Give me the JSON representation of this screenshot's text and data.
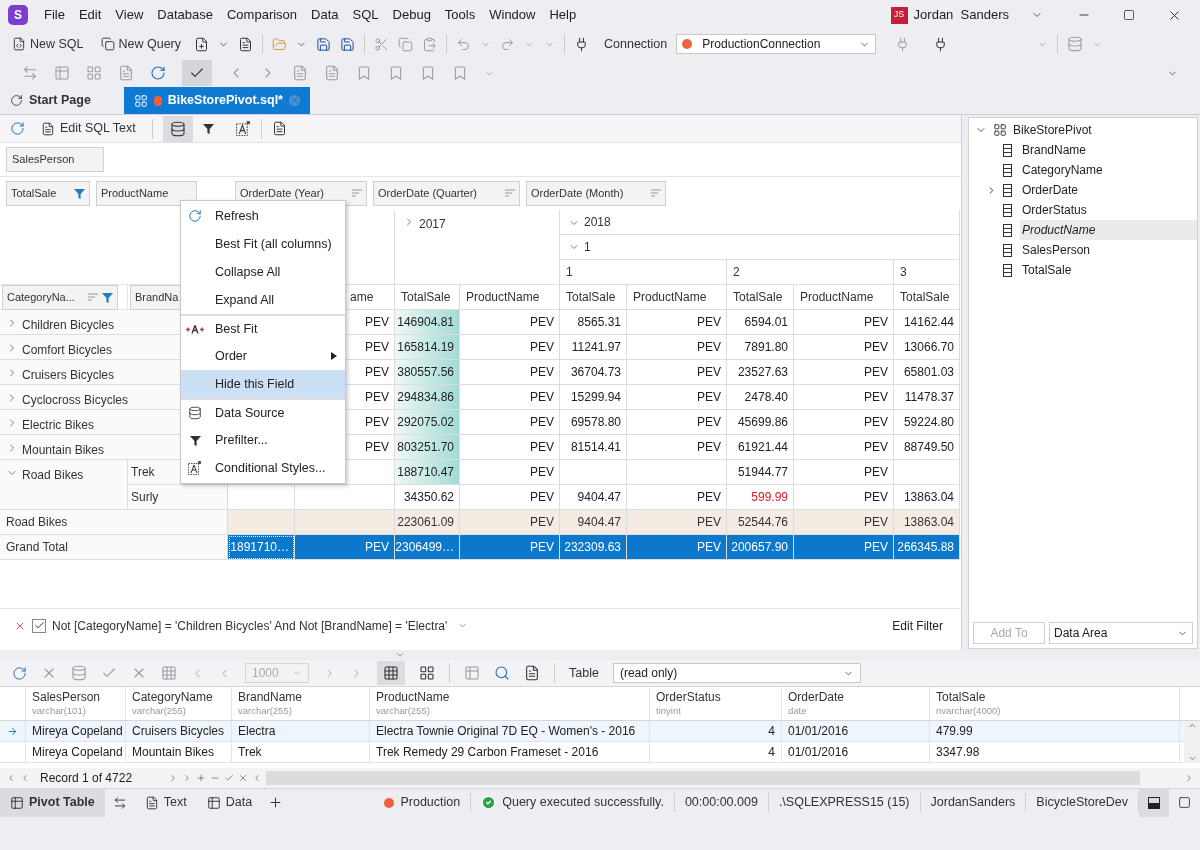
{
  "app": {
    "logo": "S",
    "menu": [
      "File",
      "Edit",
      "View",
      "Database",
      "Comparison",
      "Data",
      "SQL",
      "Debug",
      "Tools",
      "Window",
      "Help"
    ],
    "user": {
      "initials": "JS",
      "name": "Jordan  Sanders"
    }
  },
  "toolbar": {
    "buttons": [
      "New SQL",
      "New Query"
    ],
    "connection_label": "Connection",
    "connection": "ProductionConnection"
  },
  "doc_tabs": [
    {
      "label": "Start Page",
      "selected": false
    },
    {
      "label": "BikeStorePivot.sql*",
      "selected": true
    }
  ],
  "pivot_toolbar": {
    "edit_sql": "Edit SQL Text"
  },
  "pivot": {
    "filter_fields": [
      "SalesPerson"
    ],
    "data_fields": [
      {
        "label": "TotalSale",
        "filtered": true,
        "sorted": false
      },
      {
        "label": "ProductName",
        "filtered": false,
        "sorted": false
      }
    ],
    "column_fields": [
      {
        "label": "OrderDate (Year)",
        "filtered": false,
        "sorted": true
      },
      {
        "label": "OrderDate (Quarter)",
        "filtered": false,
        "sorted": true
      },
      {
        "label": "OrderDate (Month)",
        "filtered": false,
        "sorted": true
      }
    ],
    "row_fields": [
      {
        "label": "CategoryNa...",
        "filtered": true,
        "sorted": true
      },
      {
        "label": "BrandNa"
      }
    ],
    "years": [
      {
        "label": "2017",
        "expanded": false
      },
      {
        "label": "2018",
        "expanded": true
      }
    ],
    "quarters": [
      {
        "label": "1",
        "expanded": true
      }
    ],
    "months": [
      "1",
      "2",
      "3"
    ],
    "measure_headers": [
      "ame",
      "TotalSale",
      "ProductName",
      "TotalSale",
      "ProductName",
      "TotalSale",
      "ProductName",
      "TotalSale"
    ],
    "categories": [
      {
        "label": "Children Bicycles",
        "expanded": false,
        "cells": [
          null,
          "PEV",
          {
            "text": "146904.81",
            "kind": "databar"
          },
          "PEV",
          "8565.31",
          "PEV",
          "6594.01",
          "PEV",
          "14162.44"
        ]
      },
      {
        "label": "Comfort Bicycles",
        "expanded": false,
        "cells": [
          null,
          "PEV",
          {
            "text": "165814.19",
            "kind": "databar"
          },
          "PEV",
          "11241.97",
          "PEV",
          "7891.80",
          "PEV",
          "13066.70"
        ]
      },
      {
        "label": "Cruisers Bicycles",
        "expanded": false,
        "cells": [
          null,
          "PEV",
          {
            "text": "380557.56",
            "kind": "databar"
          },
          "PEV",
          "36704.73",
          "PEV",
          "23527.63",
          "PEV",
          "65801.03"
        ]
      },
      {
        "label": "Cyclocross Bicycles",
        "expanded": false,
        "cells": [
          null,
          "PEV",
          {
            "text": "294834.86",
            "kind": "databar"
          },
          "PEV",
          "15299.94",
          "PEV",
          "2478.40",
          "PEV",
          "11478.37"
        ]
      },
      {
        "label": "Electric Bikes",
        "expanded": false,
        "cells": [
          null,
          "PEV",
          {
            "text": "292075.02",
            "kind": "databar"
          },
          "PEV",
          "69578.80",
          "PEV",
          "45699.86",
          "PEV",
          "59224.80"
        ]
      },
      {
        "label": "Mountain Bikes",
        "expanded": false,
        "cells": [
          null,
          "PEV",
          {
            "text": "803251.70",
            "kind": "databar"
          },
          "PEV",
          "81514.41",
          "PEV",
          "61921.44",
          "PEV",
          "88749.50"
        ]
      },
      {
        "label": "Road Bikes",
        "expanded": true,
        "children": [
          {
            "label": "Trek",
            "cells": [
              null,
              null,
              {
                "text": "188710.47",
                "kind": "databar"
              },
              "PEV",
              null,
              null,
              "51944.77",
              "PEV",
              null
            ]
          },
          {
            "label": "Surly",
            "cells": [
              null,
              null,
              "34350.62",
              "PEV",
              "9404.47",
              "PEV",
              {
                "text": "599.99",
                "kind": "negative"
              },
              "PEV",
              "13863.04"
            ]
          }
        ]
      }
    ],
    "totals": [
      {
        "kind": "subtotal",
        "label": "Road Bikes",
        "cells": [
          null,
          null,
          "223061.09",
          "PEV",
          "9404.47",
          "PEV",
          "52544.76",
          "PEV",
          "13863.04"
        ]
      },
      {
        "kind": "grand_total",
        "label": "Grand Total",
        "cells": [
          "1891710…",
          "PEV",
          "2306499…",
          "PEV",
          "232309.63",
          "PEV",
          "200657.90",
          "PEV",
          "266345.88"
        ]
      }
    ]
  },
  "context_menu": [
    {
      "label": "Refresh",
      "selected": false,
      "submenu": false,
      "separator_before": false
    },
    {
      "label": "Best Fit (all columns)",
      "selected": false,
      "submenu": false,
      "separator_before": false
    },
    {
      "label": "Collapse All",
      "selected": false,
      "submenu": false,
      "separator_before": false
    },
    {
      "label": "Expand All",
      "selected": false,
      "submenu": false,
      "separator_before": false
    },
    {
      "label": "Best Fit",
      "selected": false,
      "submenu": false,
      "separator_before": true
    },
    {
      "label": "Order",
      "selected": false,
      "submenu": true,
      "separator_before": false
    },
    {
      "label": "Hide this Field",
      "selected": true,
      "submenu": false,
      "separator_before": false
    },
    {
      "label": "Data Source",
      "selected": false,
      "submenu": false,
      "separator_before": true
    },
    {
      "label": "Prefilter...",
      "selected": false,
      "submenu": false,
      "separator_before": false
    },
    {
      "label": "Conditional Styles...",
      "selected": false,
      "submenu": false,
      "separator_before": false
    }
  ],
  "filter_bar": {
    "enabled": true,
    "text": "Not [CategoryName] = 'Children Bicycles' And Not [BrandName] = 'Electra'",
    "edit": "Edit Filter"
  },
  "field_list": {
    "label": "BikeStorePivot",
    "expanded": true,
    "children": [
      {
        "label": "BrandName",
        "selected": false
      },
      {
        "label": "CategoryName",
        "selected": false
      },
      {
        "label": "OrderDate",
        "selected": false,
        "expanded": false
      },
      {
        "label": "OrderStatus",
        "selected": false
      },
      {
        "label": "ProductName",
        "selected": true
      },
      {
        "label": "SalesPerson",
        "selected": false
      },
      {
        "label": "TotalSale",
        "selected": false
      }
    ],
    "add_to": {
      "label": "Add To",
      "disabled": true
    },
    "area": "Data Area"
  },
  "data_grid": {
    "page_size": "1000",
    "table_label": "Table",
    "table": "(read only)",
    "columns": [
      {
        "name": "SalesPerson",
        "type": "varchar(101)"
      },
      {
        "name": "CategoryName",
        "type": "varchar(255)"
      },
      {
        "name": "BrandName",
        "type": "varchar(255)"
      },
      {
        "name": "ProductName",
        "type": "varchar(255)"
      },
      {
        "name": "OrderStatus",
        "type": "tinyint"
      },
      {
        "name": "OrderDate",
        "type": "date"
      },
      {
        "name": "TotalSale",
        "type": "nvarchar(4000)"
      }
    ],
    "rows": [
      {
        "current": true,
        "cells": [
          "Mireya Copeland",
          "Cruisers Bicycles",
          "Electra",
          "Electra Townie Original 7D EQ - Women's - 2016",
          "4",
          "01/01/2016",
          "479.99"
        ]
      },
      {
        "current": false,
        "cells": [
          "Mireya Copeland",
          "Mountain Bikes",
          "Trek",
          "Trek Remedy 29 Carbon Frameset - 2016",
          "4",
          "01/01/2016",
          "3347.98"
        ]
      }
    ],
    "record": "Record 1 of 4722"
  },
  "status_bar": {
    "tabs": [
      {
        "label": "Pivot Table",
        "selected": true
      },
      {
        "label": "Text",
        "selected": false
      },
      {
        "label": "Data",
        "selected": false
      }
    ],
    "connection": "Production",
    "message": "Query executed successfully.",
    "time": "00:00:00.009",
    "server": ".\\SQLEXPRESS15 (15)",
    "user": "JordanSanders",
    "database": "BicycleStoreDev"
  }
}
